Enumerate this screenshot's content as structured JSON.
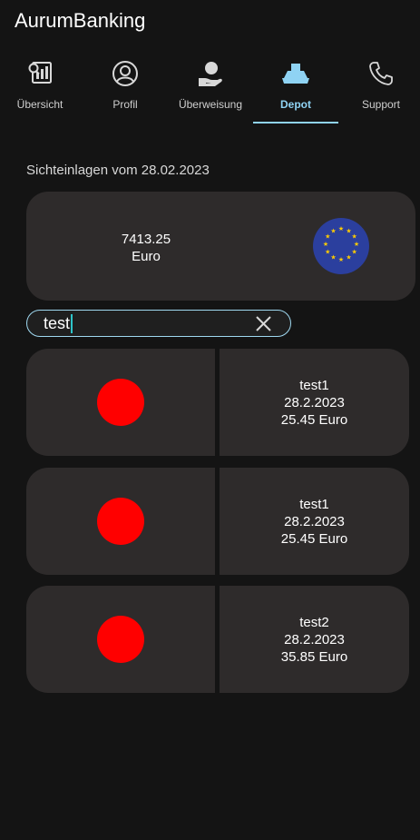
{
  "app": {
    "title": "AurumBanking"
  },
  "tabs": [
    {
      "label": "Übersicht",
      "icon": "overview-chart-icon",
      "active": false
    },
    {
      "label": "Profil",
      "icon": "profile-icon",
      "active": false
    },
    {
      "label": "Überweisung",
      "icon": "transfer-hand-icon",
      "active": false
    },
    {
      "label": "Depot",
      "icon": "depot-icon",
      "active": true
    },
    {
      "label": "Support",
      "icon": "phone-icon",
      "active": false
    }
  ],
  "colors": {
    "accent": "#8fd3f4",
    "card": "#2e2b2b",
    "background": "#141414",
    "status_dot": "#ff0000",
    "eu_blue": "#2b3f9e",
    "eu_star": "#ffcc00"
  },
  "depot": {
    "heading": "Sichteinlagen vom 28.02.2023",
    "balance": {
      "amount": "7413.25",
      "currency": "Euro",
      "icon": "eu-flag-icon"
    }
  },
  "search": {
    "value": "test",
    "clear_icon": "close-icon"
  },
  "transactions": [
    {
      "name": "test1",
      "date": "28.2.2023",
      "amount": "25.45 Euro",
      "status_color": "#ff0000"
    },
    {
      "name": "test1",
      "date": "28.2.2023",
      "amount": "25.45 Euro",
      "status_color": "#ff0000"
    },
    {
      "name": "test2",
      "date": "28.2.2023",
      "amount": "35.85 Euro",
      "status_color": "#ff0000"
    }
  ]
}
